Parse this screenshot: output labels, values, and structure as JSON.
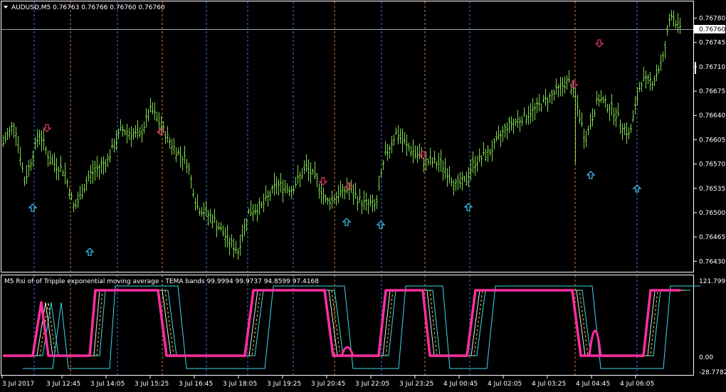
{
  "main": {
    "title": "AUDUSD,M5  0.76763 0.76766 0.76760 0.76760",
    "current_price": "0.76760",
    "price_min": 0.76419,
    "price_max": 0.76798,
    "price_labels": [
      "0.76780",
      "0.76745",
      "0.76710",
      "0.76675",
      "0.76640",
      "0.76605",
      "0.76570",
      "0.76535",
      "0.76500",
      "0.76465",
      "0.76430"
    ],
    "candle_color": "#7fd94a",
    "down_arrow_color": "#e0306a",
    "up_arrow_color": "#3ab8e8"
  },
  "sub": {
    "title": "M5 Rsi of of Tripple exponential moving average - TEMA bands 99.9994 99.9737 94.8599 97.4168",
    "scale_max": "121.7995",
    "scale_zero": "0.00",
    "scale_min": "-28.7782",
    "line_main_color": "#ff2fa0",
    "line_band_color": "#40d8e8",
    "line_dash_color": "#e8e040",
    "line_inner_color": "#e8e8e8"
  },
  "time_axis": {
    "labels": [
      "3 Jul 2017",
      "3 Jul 12:45",
      "3 Jul 14:05",
      "3 Jul 15:25",
      "3 Jul 16:45",
      "3 Jul 18:05",
      "3 Jul 19:25",
      "3 Jul 20:45",
      "3 Jul 22:05",
      "3 Jul 23:25",
      "4 Jul 00:45",
      "4 Jul 02:05",
      "4 Jul 03:25",
      "4 Jul 04:45",
      "4 Jul 06:05"
    ]
  }
}
